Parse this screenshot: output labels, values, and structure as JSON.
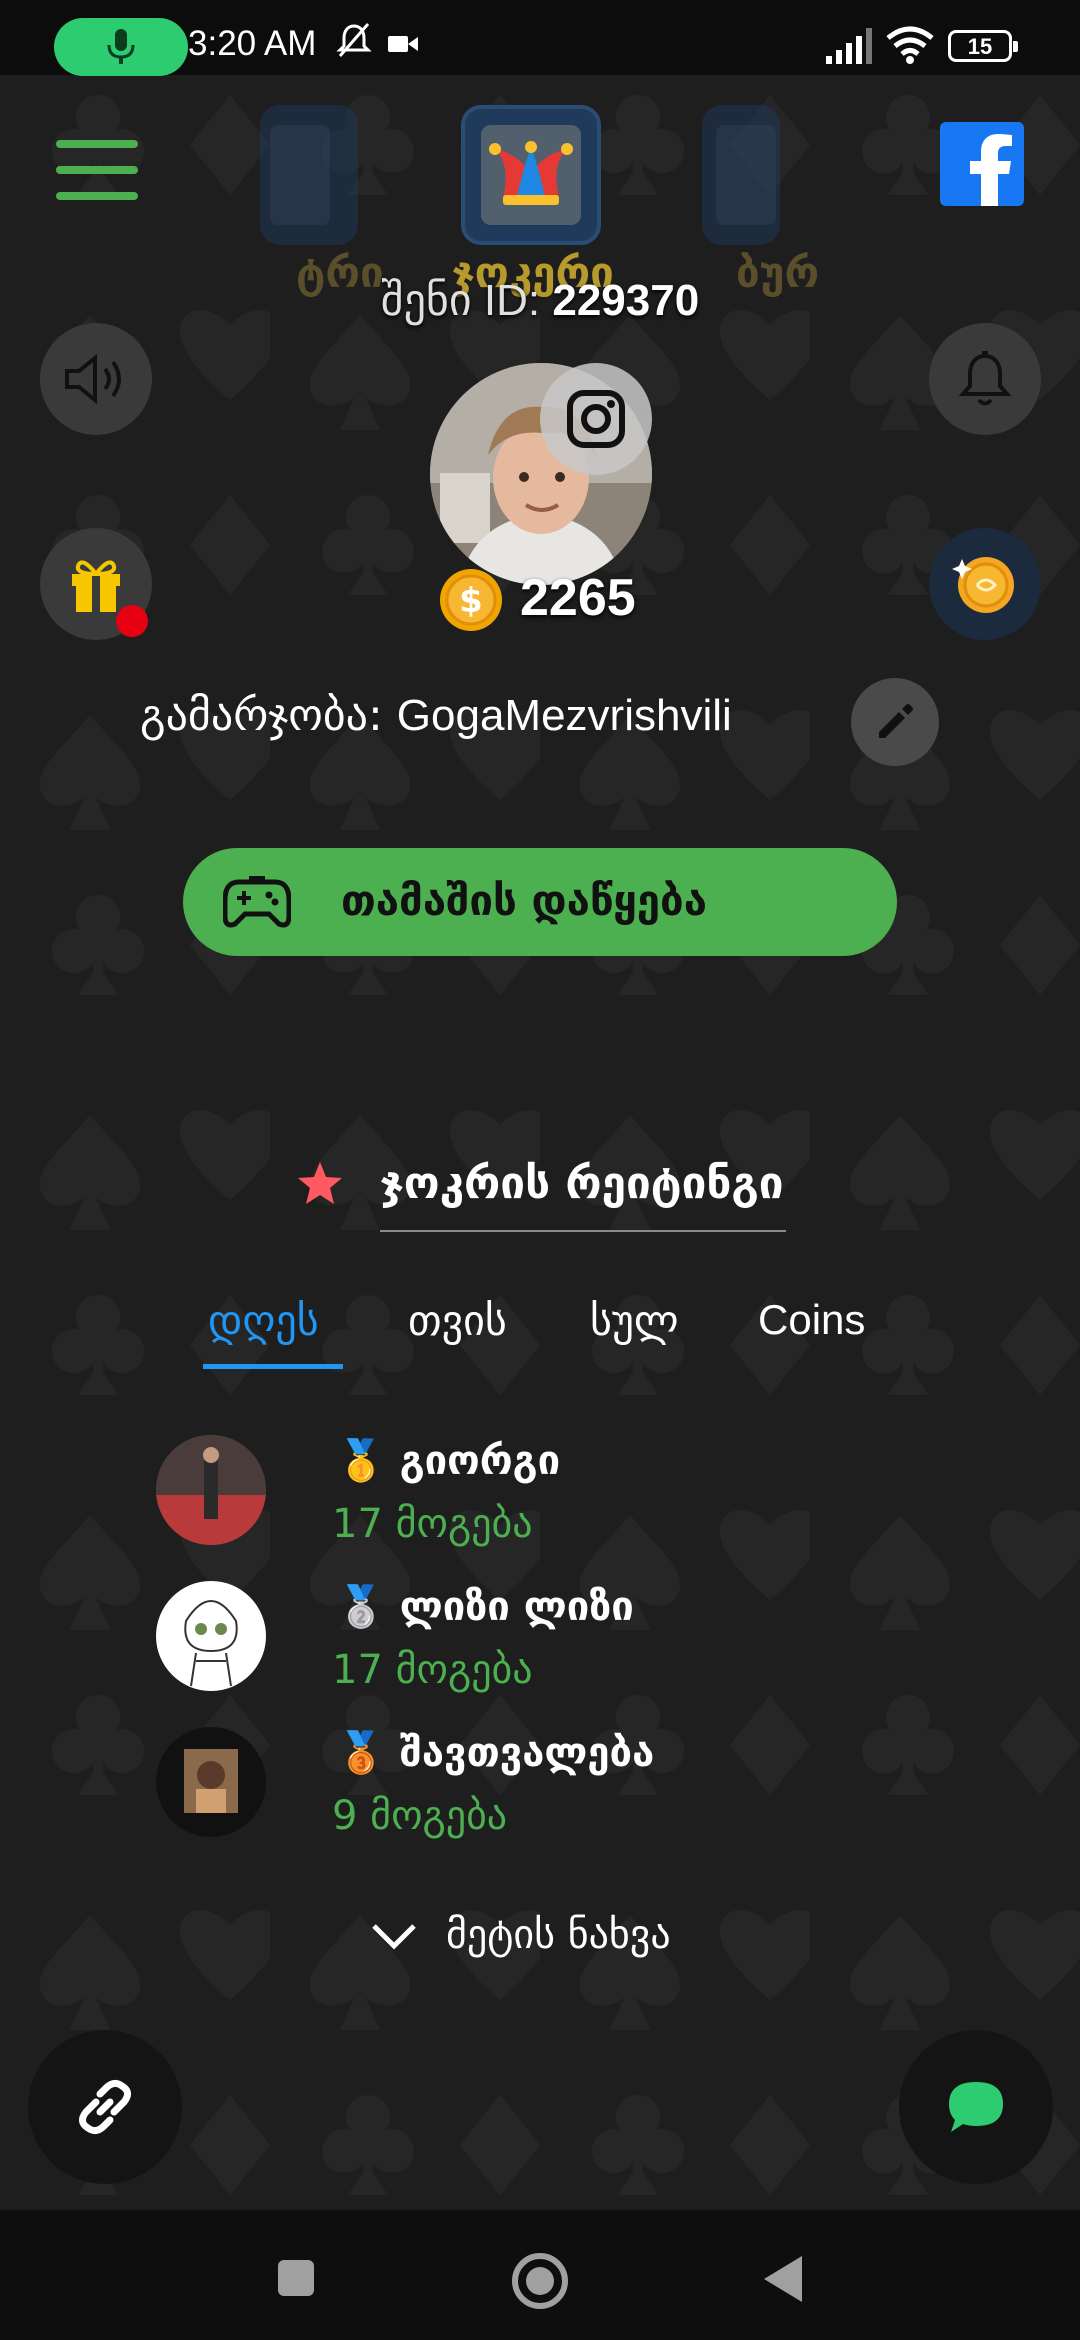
{
  "status_bar": {
    "time": "3:20 AM",
    "battery": "15",
    "icons": [
      "mic-icon",
      "mute-bell-icon",
      "video-icon",
      "signal-icon",
      "wifi-icon",
      "battery-icon"
    ]
  },
  "top": {
    "menu_icon": "hamburger-menu-icon",
    "facebook_icon": "facebook-icon",
    "games": [
      {
        "label": "ტრი",
        "state": "side"
      },
      {
        "label": "ჯოკერი",
        "state": "active"
      },
      {
        "label": "ბურ",
        "state": "side"
      }
    ],
    "player_id_label": "შენი ID:",
    "player_id": "229370"
  },
  "profile": {
    "coins": "2265",
    "greeting_label": "გამარჯობა:",
    "username": "GogaMezvrishvili",
    "instagram_icon": "instagram-icon",
    "edit_icon": "pencil-icon",
    "sound_icon": "speaker-icon",
    "notifications_icon": "bell-icon",
    "gift_icon": "gift-icon",
    "bonus_icon": "coin-sparkle-icon"
  },
  "play": {
    "label": "თამაშის დაწყება",
    "icon": "gamepad-icon"
  },
  "rating": {
    "title": "ჯოკრის რეიტინგი",
    "tabs": [
      {
        "label": "დღეს",
        "active": true
      },
      {
        "label": "თვის",
        "active": false
      },
      {
        "label": "სულ",
        "active": false
      },
      {
        "label": "Coins",
        "active": false
      }
    ],
    "leaders": [
      {
        "medal": "🥇",
        "name": "გიორგი",
        "wins": "17 მოგება"
      },
      {
        "medal": "🥈",
        "name": "ლიზი ლიზი",
        "wins": "17 მოგება"
      },
      {
        "medal": "🥉",
        "name": "შავთვალება",
        "wins": "9 მოგება"
      }
    ],
    "see_more": "მეტის ნახვა"
  },
  "fabs": {
    "left_icon": "link-icon",
    "right_icon": "chat-bubble-icon"
  },
  "colors": {
    "accent_green": "#4caf50",
    "tab_blue": "#2196f3",
    "background": "#1e1e1e"
  }
}
